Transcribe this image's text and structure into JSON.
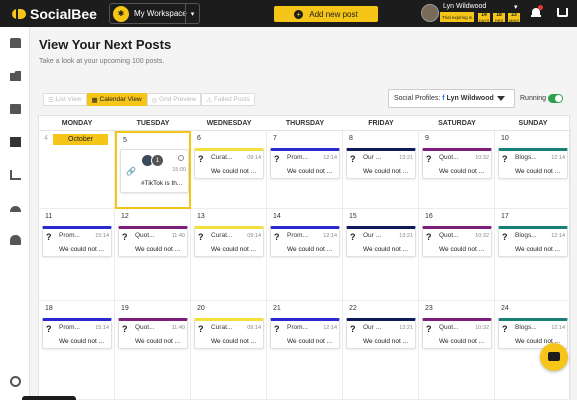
{
  "app": {
    "name": "SocialBee"
  },
  "workspace": {
    "label": "My Workspace",
    "avatar_glyph": "✱"
  },
  "topbar": {
    "add_post_label": "Add new post",
    "add_icon": "plus-icon"
  },
  "user": {
    "name": "Lyn Wildwood",
    "trial_label": "Trial expiring in",
    "trial_days": "14",
    "trial_days_unit": "DAYS",
    "trial_hours": "18",
    "trial_hours_unit": "HRS",
    "trial_minutes": "23",
    "trial_minutes_unit": "MINS"
  },
  "page": {
    "title": "View Your Next Posts",
    "subtitle": "Take a look at your upcoming 100 posts."
  },
  "views": [
    {
      "label": "List View",
      "icon": "list-icon",
      "active": false
    },
    {
      "label": "Calendar View",
      "icon": "calendar-icon",
      "active": true
    },
    {
      "label": "Grid Preview",
      "icon": "grid-icon",
      "active": false
    },
    {
      "label": "Failed Posts",
      "icon": "alert-icon",
      "active": false
    }
  ],
  "social_profiles": {
    "label": "Social Profiles:",
    "network_icon": "f",
    "value": "Lyn Wildwood"
  },
  "running": {
    "label": "Running",
    "on": true
  },
  "calendar": {
    "weekdays": [
      "MONDAY",
      "TUESDAY",
      "WEDNESDAY",
      "THURSDAY",
      "FRIDAY",
      "SATURDAY",
      "SUNDAY"
    ],
    "month_badge": "October",
    "colors": {
      "curated": "#f2e03c",
      "promo": "#2a2acf",
      "ours": "#0f1a5a",
      "quote": "#7b1f7a",
      "blogs": "#1a7f77"
    },
    "error_text": "We could not ...",
    "today_post": {
      "count": "1",
      "time": "15:00",
      "text": "#TikTok is th..."
    },
    "weeks": [
      {
        "days": [
          {
            "num": "4",
            "muted": true,
            "month_badge": true
          },
          {
            "num": "5",
            "today": true
          },
          {
            "num": "6",
            "post": {
              "title": "Curat...",
              "time": "09:14",
              "color": "#f2e03c"
            }
          },
          {
            "num": "7",
            "post": {
              "title": "Prom...",
              "time": "12:14",
              "color": "#2a2acf"
            }
          },
          {
            "num": "8",
            "post": {
              "title": "Our ...",
              "time": "13:21",
              "color": "#0f1a5a"
            }
          },
          {
            "num": "9",
            "post": {
              "title": "Quot...",
              "time": "10:32",
              "color": "#7b1f7a"
            }
          },
          {
            "num": "10",
            "post": {
              "title": "Blogs...",
              "time": "12:14",
              "color": "#1a7f77"
            }
          }
        ]
      },
      {
        "days": [
          {
            "num": "11",
            "post": {
              "title": "Prom...",
              "time": "15:14",
              "color": "#2a2acf"
            }
          },
          {
            "num": "12",
            "post": {
              "title": "Quot...",
              "time": "11:40",
              "color": "#7b1f7a"
            }
          },
          {
            "num": "13",
            "post": {
              "title": "Curat...",
              "time": "09:14",
              "color": "#f2e03c"
            }
          },
          {
            "num": "14",
            "post": {
              "title": "Prom...",
              "time": "12:14",
              "color": "#2a2acf"
            }
          },
          {
            "num": "15",
            "post": {
              "title": "Our ...",
              "time": "13:21",
              "color": "#0f1a5a"
            }
          },
          {
            "num": "16",
            "post": {
              "title": "Quot...",
              "time": "10:32",
              "color": "#7b1f7a"
            }
          },
          {
            "num": "17",
            "post": {
              "title": "Blogs...",
              "time": "12:14",
              "color": "#1a7f77"
            }
          }
        ]
      },
      {
        "days": [
          {
            "num": "18",
            "post": {
              "title": "Prom...",
              "time": "15:14",
              "color": "#2a2acf"
            }
          },
          {
            "num": "19",
            "post": {
              "title": "Quot...",
              "time": "11:40",
              "color": "#7b1f7a"
            }
          },
          {
            "num": "20",
            "post": {
              "title": "Curat...",
              "time": "09:14",
              "color": "#f2e03c"
            }
          },
          {
            "num": "21",
            "post": {
              "title": "Prom...",
              "time": "12:14",
              "color": "#2a2acf"
            }
          },
          {
            "num": "22",
            "post": {
              "title": "Our ...",
              "time": "13:21",
              "color": "#0f1a5a"
            }
          },
          {
            "num": "23",
            "post": {
              "title": "Quot...",
              "time": "10:32",
              "color": "#7b1f7a"
            }
          },
          {
            "num": "24",
            "post": {
              "title": "Blogs...",
              "time": "12:14",
              "color": "#1a7f77"
            }
          }
        ]
      }
    ]
  },
  "sidebar": {
    "icons": [
      "clipboard-icon",
      "folder-icon",
      "calendar-icon",
      "list-icon",
      "analytics-icon",
      "inbox-icon",
      "users-icon",
      "help-icon"
    ]
  },
  "chat": {
    "icon": "chat-icon"
  }
}
